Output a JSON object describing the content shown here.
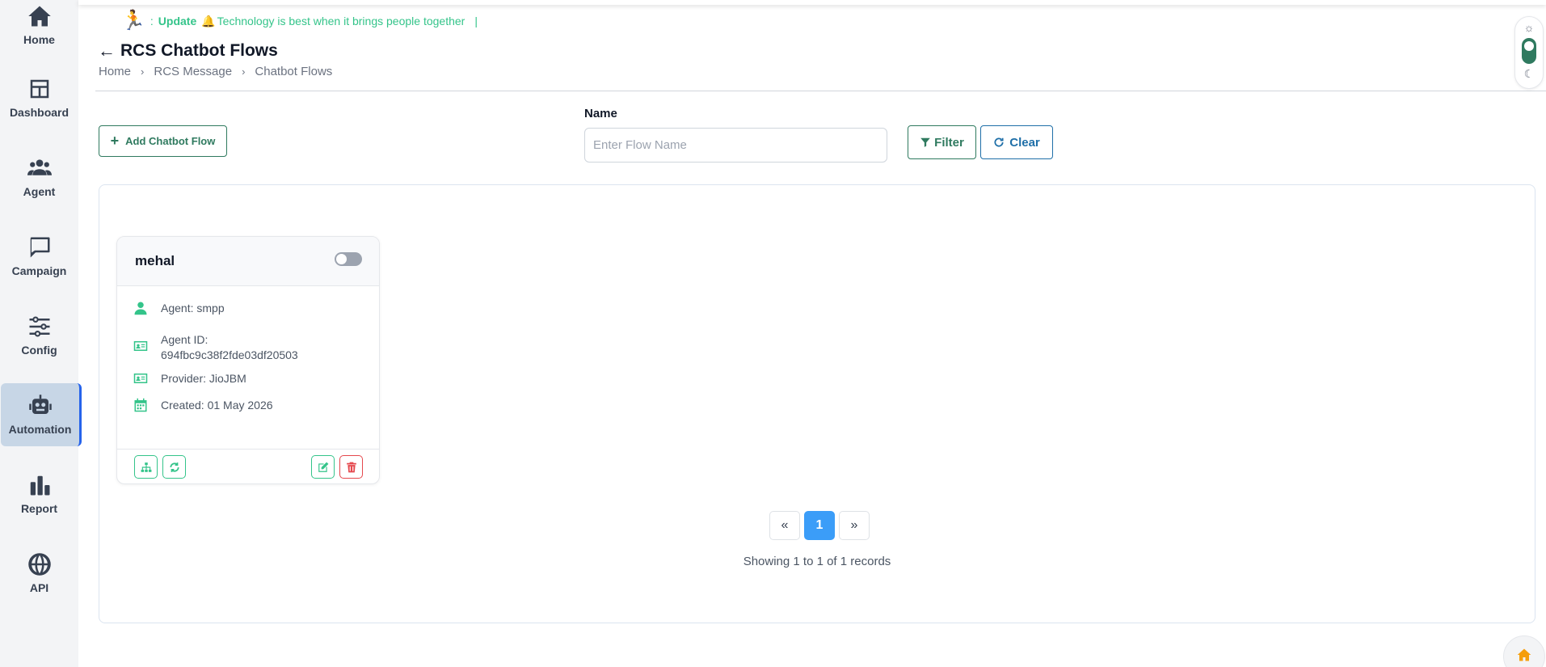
{
  "sidebar": {
    "items": [
      {
        "label": "Home",
        "icon": "home-icon"
      },
      {
        "label": "Dashboard",
        "icon": "dashboard-icon"
      },
      {
        "label": "Agent",
        "icon": "users-icon"
      },
      {
        "label": "Campaign",
        "icon": "chat-icon"
      },
      {
        "label": "Config",
        "icon": "sliders-icon"
      },
      {
        "label": "Automation",
        "icon": "robot-icon",
        "active": true
      },
      {
        "label": "Report",
        "icon": "bar-chart-icon"
      },
      {
        "label": "API",
        "icon": "globe-icon"
      }
    ]
  },
  "marquee": {
    "prefix": ":",
    "update_label": "Update",
    "message": "Technology is best when it brings people together",
    "cursor": "|"
  },
  "header": {
    "title": "RCS Chatbot Flows",
    "breadcrumb": [
      "Home",
      "RCS Message",
      "Chatbot Flows"
    ]
  },
  "toolbar": {
    "add_label": "Add Chatbot Flow",
    "name_label": "Name",
    "name_placeholder": "Enter Flow Name",
    "name_value": "",
    "filter_label": "Filter",
    "clear_label": "Clear"
  },
  "flows": [
    {
      "name": "mehal",
      "enabled": false,
      "agent": "Agent: smpp",
      "agent_id_label": "Agent ID:",
      "agent_id": "694fbc9c38f2fde03df20503",
      "provider": "Provider: JioJBM",
      "created": "Created: 01 May 2026"
    }
  ],
  "pagination": {
    "prev": "«",
    "current": "1",
    "next": "»",
    "summary": "Showing 1 to 1 of 1 records"
  },
  "colors": {
    "accent_green": "#34c48a",
    "button_green": "#2f7a5f",
    "clear_blue": "#1f6fa8",
    "active_page": "#3b9df8",
    "danger": "#e5484d"
  }
}
